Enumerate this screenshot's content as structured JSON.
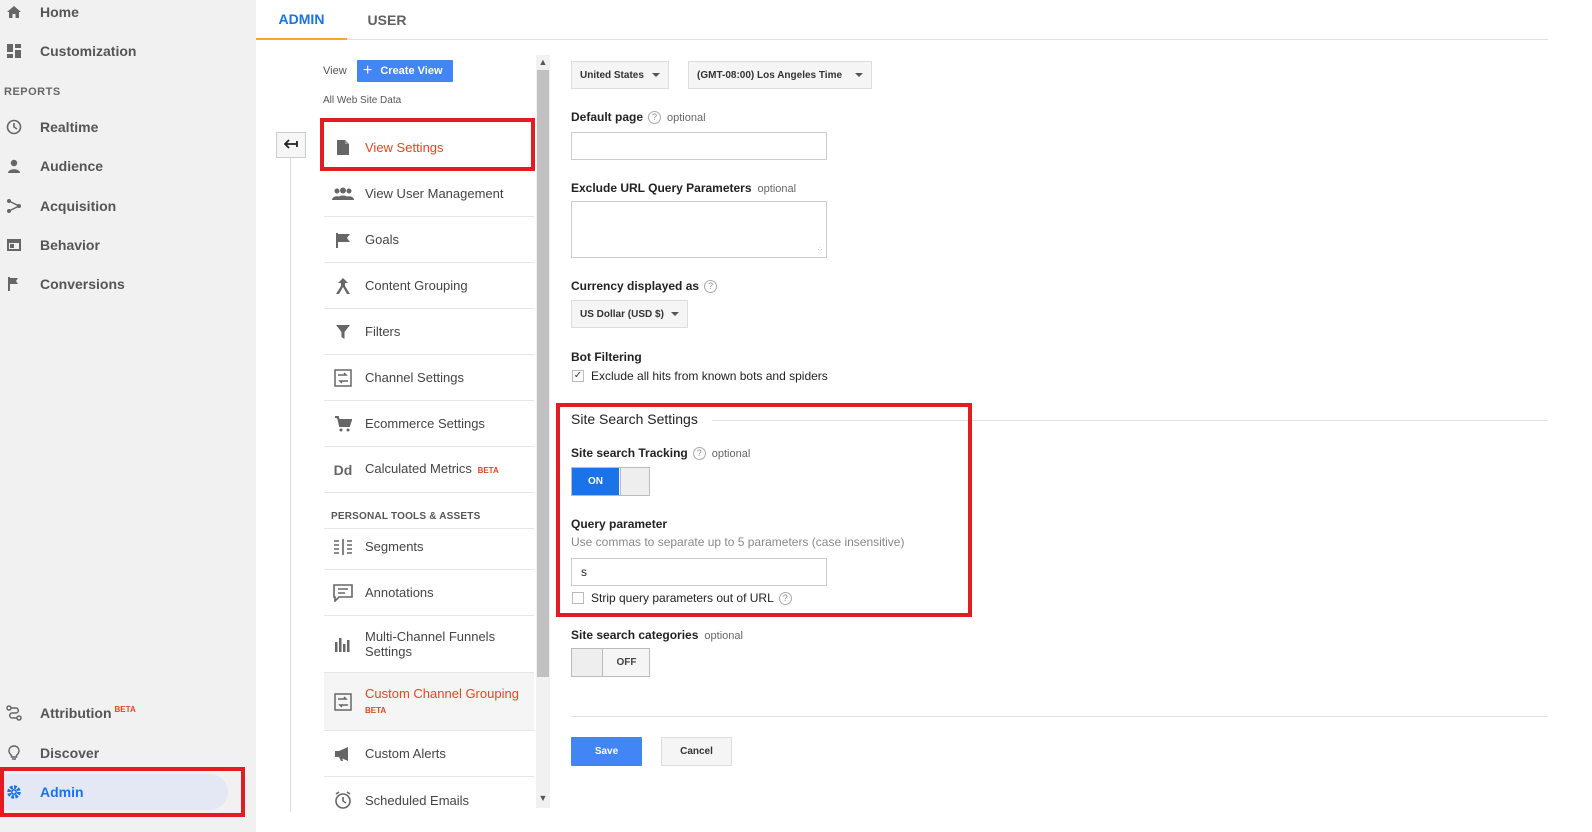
{
  "leftnav": {
    "home": "Home",
    "customization": "Customization",
    "reports_section": "REPORTS",
    "realtime": "Realtime",
    "audience": "Audience",
    "acquisition": "Acquisition",
    "behavior": "Behavior",
    "conversions": "Conversions",
    "attribution": "Attribution",
    "attribution_badge": "BETA",
    "discover": "Discover",
    "admin": "Admin"
  },
  "tabs": {
    "admin": "ADMIN",
    "user": "USER"
  },
  "view_panel": {
    "view_label": "View",
    "create_view": "Create View",
    "all_data": "All Web Site Data",
    "items": [
      {
        "label": "View Settings",
        "icon": "document-icon",
        "active": true
      },
      {
        "label": "View User Management",
        "icon": "people-icon"
      },
      {
        "label": "Goals",
        "icon": "flag-icon"
      },
      {
        "label": "Content Grouping",
        "icon": "content-grouping-icon"
      },
      {
        "label": "Filters",
        "icon": "filter-icon"
      },
      {
        "label": "Channel Settings",
        "icon": "channel-settings-icon"
      },
      {
        "label": "Ecommerce Settings",
        "icon": "cart-icon"
      },
      {
        "label": "Calculated Metrics",
        "icon": "dd-icon",
        "badge": "BETA"
      }
    ],
    "personal_section": "PERSONAL TOOLS & ASSETS",
    "personal_items": [
      {
        "label": "Segments",
        "icon": "segments-icon"
      },
      {
        "label": "Annotations",
        "icon": "annotation-icon"
      },
      {
        "label": "Multi-Channel Funnels Settings",
        "icon": "bar-chart-icon"
      },
      {
        "label": "Custom Channel Grouping",
        "icon": "channel-grouping-icon",
        "badge": "BETA",
        "active": true
      },
      {
        "label": "Custom Alerts",
        "icon": "megaphone-icon"
      },
      {
        "label": "Scheduled Emails",
        "icon": "clock-icon"
      }
    ]
  },
  "settings": {
    "country": "United States",
    "timezone": "(GMT-08:00) Los Angeles Time",
    "default_page_label": "Default page",
    "optional": "optional",
    "default_page_value": "",
    "exclude_label": "Exclude URL Query Parameters",
    "exclude_value": "",
    "currency_label": "Currency displayed as",
    "currency_value": "US Dollar (USD $)",
    "bot_label": "Bot Filtering",
    "bot_checkbox_label": "Exclude all hits from known bots and spiders",
    "site_search_title": "Site Search Settings",
    "tracking_label": "Site search Tracking",
    "tracking_state": "ON",
    "query_label": "Query parameter",
    "query_hint": "Use commas to separate up to 5 parameters (case insensitive)",
    "query_value": "s",
    "strip_label": "Strip query parameters out of URL",
    "categories_label": "Site search categories",
    "categories_state": "OFF",
    "save": "Save",
    "cancel": "Cancel"
  },
  "colors": {
    "accent": "#1a73e8",
    "highlight_red": "#e31c24",
    "active_item": "#e8451e",
    "button_blue": "#4285f4"
  }
}
